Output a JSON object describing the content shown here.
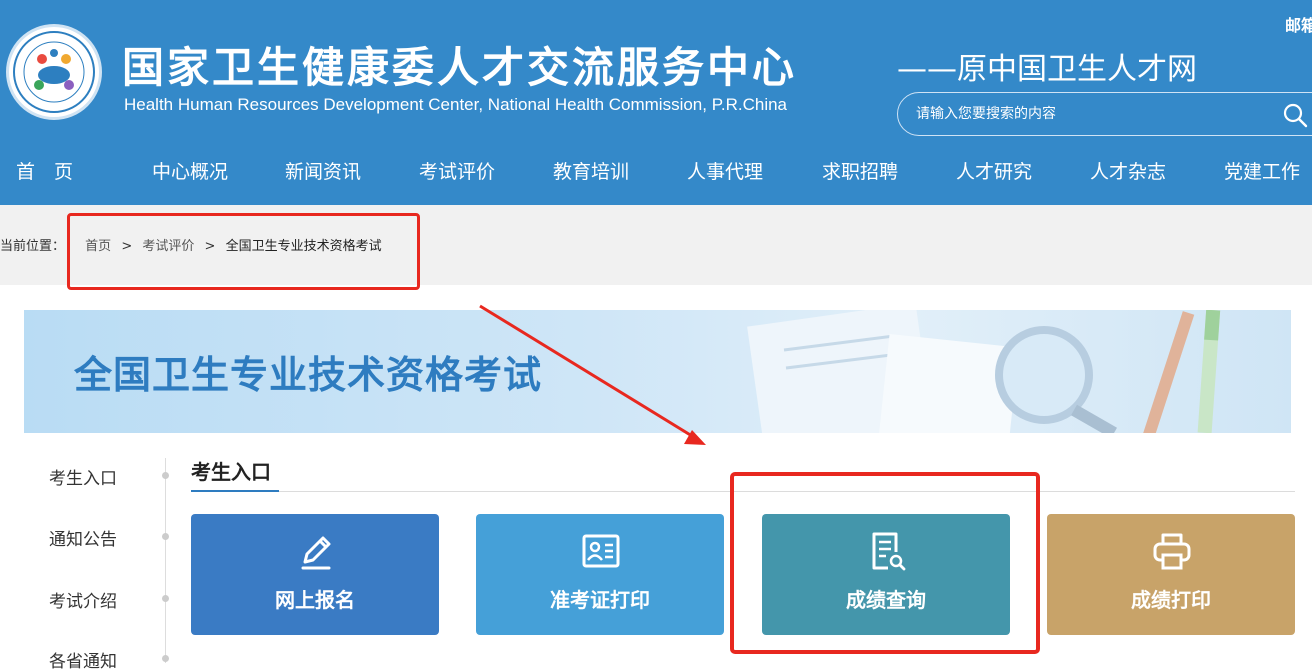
{
  "header": {
    "title": "国家卫生健康委人才交流服务中心",
    "subtitle_en": "Health Human Resources Development Center, National Health Commission, P.R.China",
    "tagline": "——原中国卫生人才网",
    "top_link": "邮箱",
    "logo_icon": "organization-logo"
  },
  "search": {
    "placeholder": "请输入您要搜索的内容",
    "icon": "search-icon"
  },
  "nav": {
    "items": [
      "首　页",
      "中心概况",
      "新闻资讯",
      "考试评价",
      "教育培训",
      "人事代理",
      "求职招聘",
      "人才研究",
      "人才杂志",
      "党建工作"
    ]
  },
  "breadcrumb": {
    "prefix": "当前位置：",
    "items": [
      "首页",
      "考试评价",
      "全国卫生专业技术资格考试"
    ],
    "separator": ">"
  },
  "banner": {
    "title": "全国卫生专业技术资格考试"
  },
  "sidebar": {
    "items": [
      "考生入口",
      "通知公告",
      "考试介绍",
      "各省通知"
    ]
  },
  "section": {
    "title": "考生入口"
  },
  "tiles": [
    {
      "label": "网上报名",
      "icon": "pencil-icon",
      "color": "#3a7bc4"
    },
    {
      "label": "准考证打印",
      "icon": "id-card-icon",
      "color": "#45a0d8"
    },
    {
      "label": "成绩查询",
      "icon": "document-search-icon",
      "color": "#4496ab"
    },
    {
      "label": "成绩打印",
      "icon": "printer-icon",
      "color": "#c8a369"
    }
  ],
  "colors": {
    "header_bg": "#3489c9",
    "annotation_red": "#e8281f",
    "breadcrumb_bg": "#f1f1f1",
    "banner_text": "#2e7cc0"
  }
}
